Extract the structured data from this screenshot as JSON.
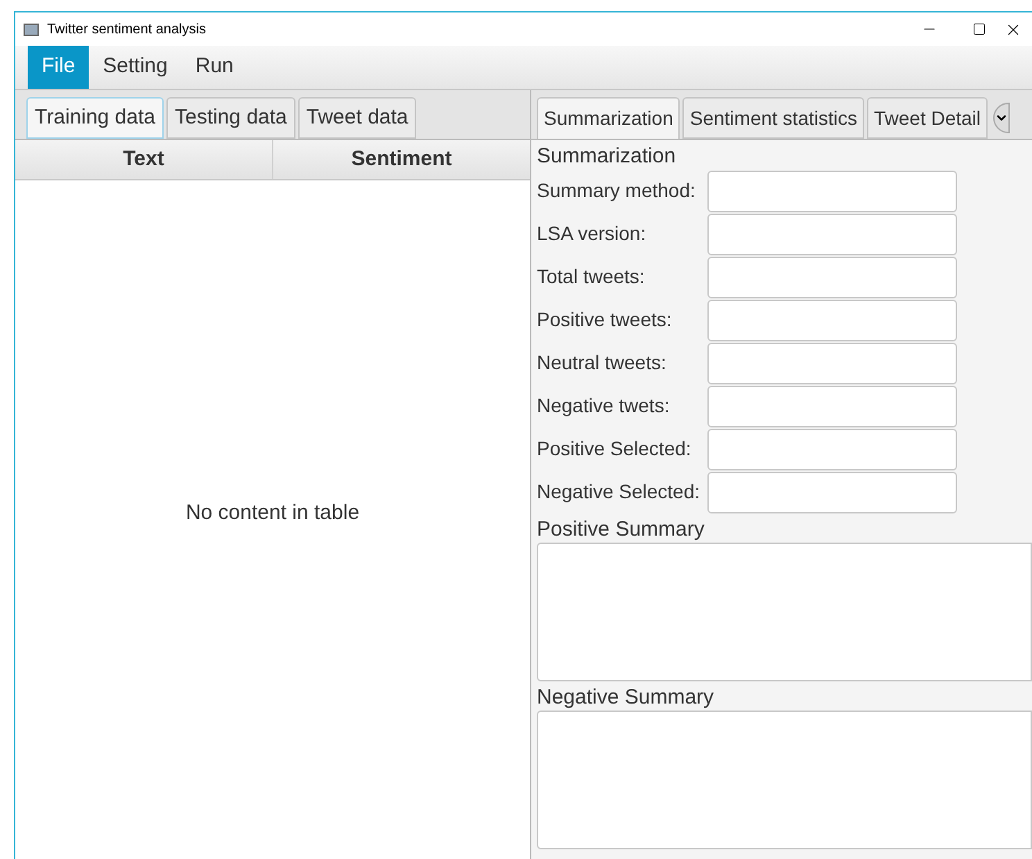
{
  "window": {
    "title": "Twitter sentiment analysis"
  },
  "menu": [
    {
      "label": "File",
      "selected": true
    },
    {
      "label": "Setting",
      "selected": false
    },
    {
      "label": "Run",
      "selected": false
    }
  ],
  "left_tabs": [
    {
      "label": "Training data",
      "selected": true
    },
    {
      "label": "Testing data",
      "selected": false
    },
    {
      "label": "Tweet data",
      "selected": false
    }
  ],
  "table": {
    "columns": [
      "Text",
      "Sentiment"
    ],
    "placeholder": "No content in table"
  },
  "right_tabs": [
    {
      "label": "Summarization",
      "selected": true
    },
    {
      "label": "Sentiment statistics",
      "selected": false
    },
    {
      "label": "Tweet Detail",
      "selected": false
    }
  ],
  "summarization": {
    "title": "Summarization",
    "fields": [
      {
        "label": "Summary method:"
      },
      {
        "label": "LSA version:"
      },
      {
        "label": "Total tweets:"
      },
      {
        "label": "Positive tweets:"
      },
      {
        "label": "Neutral tweets:"
      },
      {
        "label": "Negative twets:"
      },
      {
        "label": "Positive Selected:"
      },
      {
        "label": "Negative Selected:"
      }
    ],
    "summaries": [
      {
        "label": "Positive Summary"
      },
      {
        "label": "Negative Summary"
      }
    ]
  }
}
